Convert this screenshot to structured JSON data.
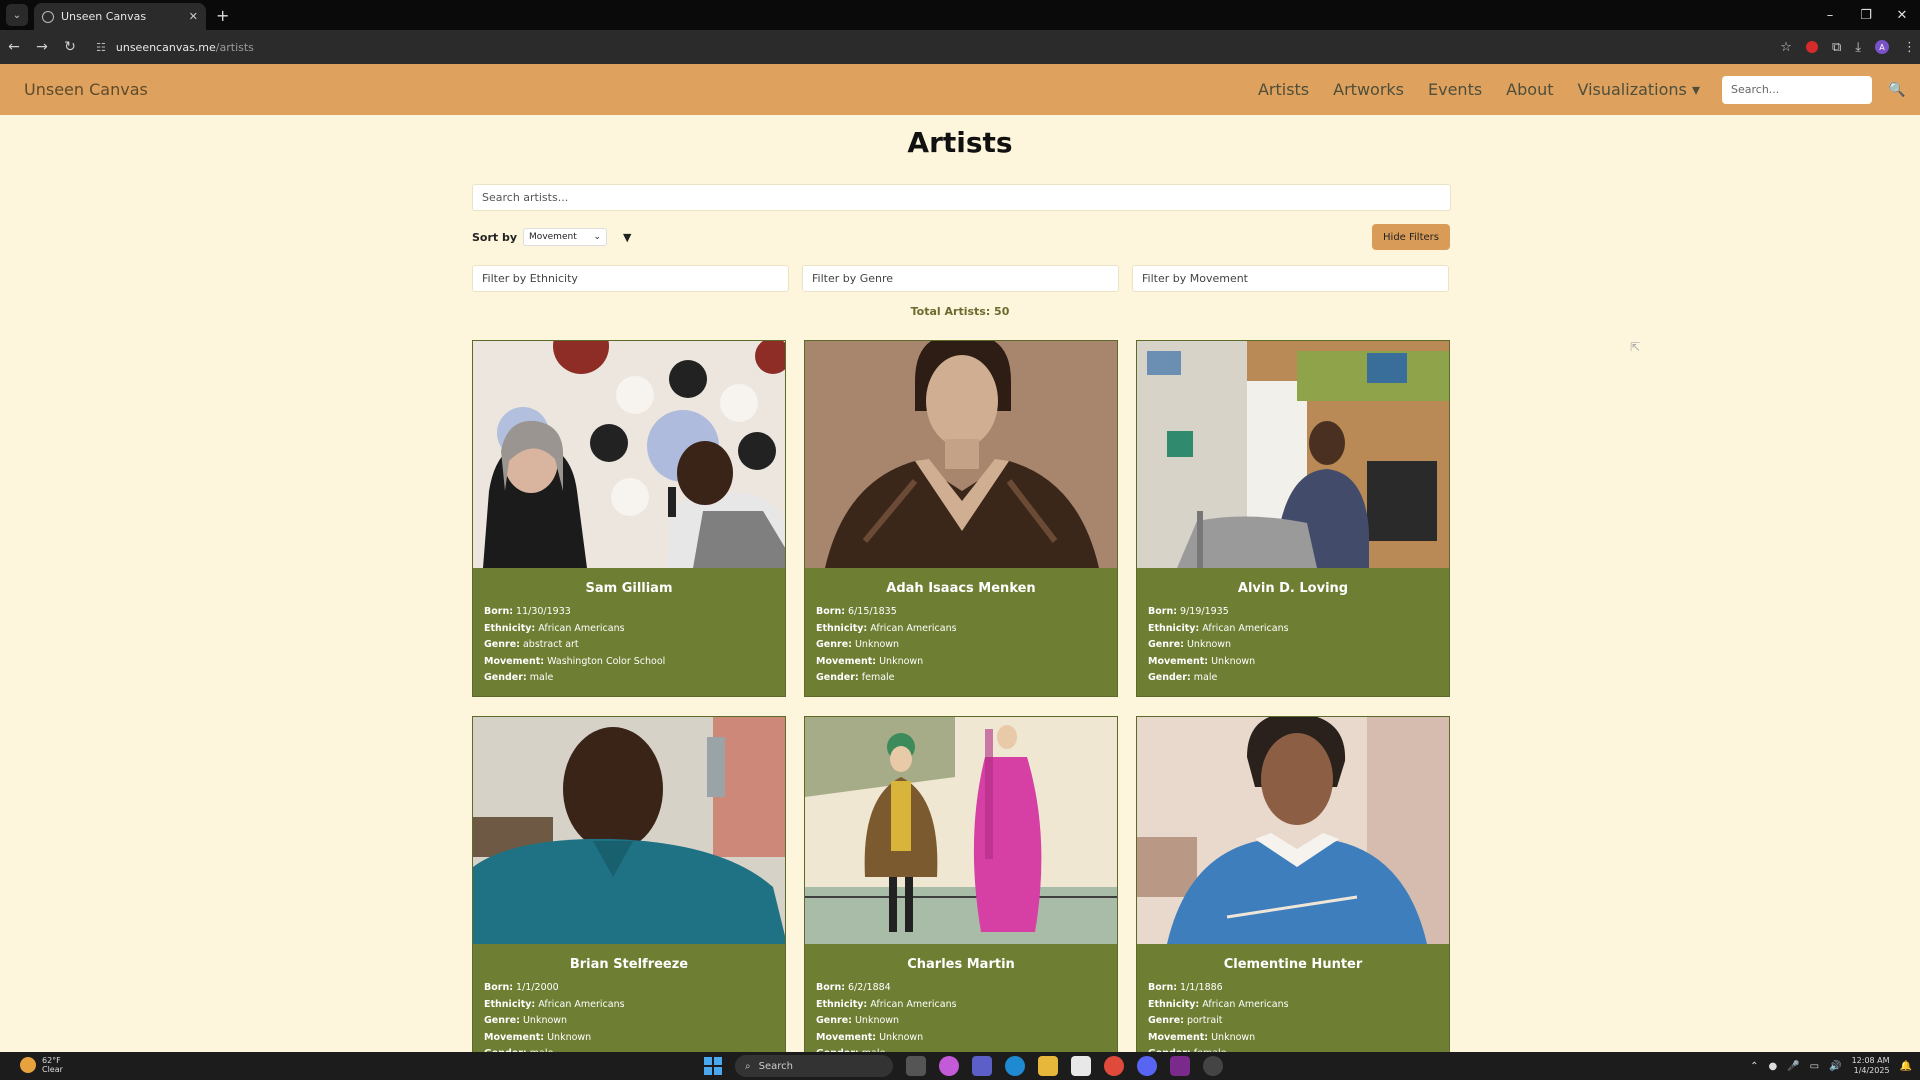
{
  "browser": {
    "tab_title": "Unseen Canvas",
    "url_host": "unseencanvas.me",
    "url_path": "/artists",
    "new_tab": "+",
    "tab_close": "✕"
  },
  "site": {
    "brand": "Unseen Canvas",
    "nav": [
      "Artists",
      "Artworks",
      "Events",
      "About",
      "Visualizations ▾"
    ],
    "search_placeholder": "Search..."
  },
  "main": {
    "title": "Artists",
    "search_placeholder": "Search artists...",
    "sort_label": "Sort by",
    "sort_value": "Movement",
    "sort_direction_icon": "▼",
    "hide_filters_label": "Hide Filters",
    "filters": [
      "Filter by Ethnicity",
      "Filter by Genre",
      "Filter by Movement"
    ],
    "total": "Total Artists: 50"
  },
  "field_labels": {
    "born": "Born:",
    "ethnicity": "Ethnicity:",
    "genre": "Genre:",
    "movement": "Movement:",
    "gender": "Gender:"
  },
  "artists": [
    {
      "name": "Sam Gilliam",
      "born": "11/30/1933",
      "ethnicity": "African Americans",
      "genre": "abstract art",
      "movement": "Washington Color School",
      "gender": "male"
    },
    {
      "name": "Adah Isaacs Menken",
      "born": "6/15/1835",
      "ethnicity": "African Americans",
      "genre": "Unknown",
      "movement": "Unknown",
      "gender": "female"
    },
    {
      "name": "Alvin D. Loving",
      "born": "9/19/1935",
      "ethnicity": "African Americans",
      "genre": "Unknown",
      "movement": "Unknown",
      "gender": "male"
    },
    {
      "name": "Brian Stelfreeze",
      "born": "1/1/2000",
      "ethnicity": "African Americans",
      "genre": "Unknown",
      "movement": "Unknown",
      "gender": "male"
    },
    {
      "name": "Charles Martin",
      "born": "6/2/1884",
      "ethnicity": "African Americans",
      "genre": "Unknown",
      "movement": "Unknown",
      "gender": "male"
    },
    {
      "name": "Clementine Hunter",
      "born": "1/1/1886",
      "ethnicity": "African Americans",
      "genre": "portrait",
      "movement": "Unknown",
      "gender": "female"
    }
  ],
  "taskbar": {
    "weather_temp": "62°F",
    "weather_desc": "Clear",
    "search_label": "Search",
    "time": "12:08 AM",
    "date": "1/4/2025"
  }
}
